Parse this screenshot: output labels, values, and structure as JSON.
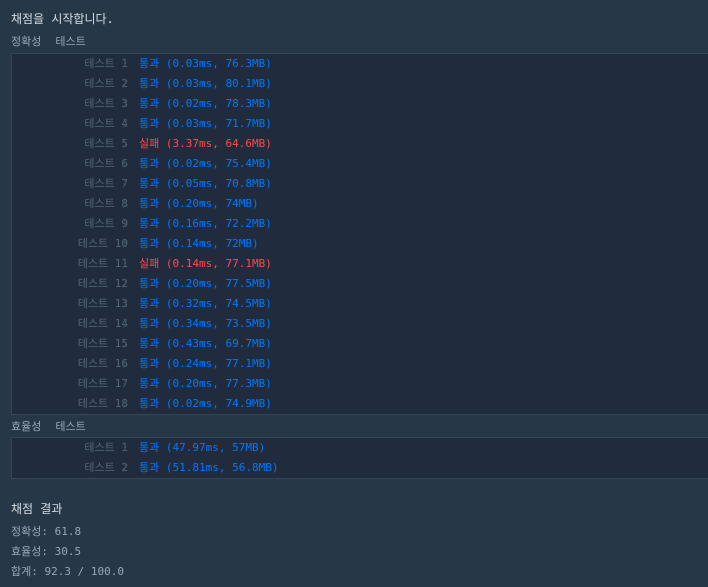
{
  "start_message": "채점을 시작합니다.",
  "accuracy": {
    "title_a": "정확성",
    "title_b": "테스트",
    "tests": [
      {
        "name": "테스트 1",
        "result": "통과",
        "detail": "(0.03ms, 76.3MB)",
        "status": "pass"
      },
      {
        "name": "테스트 2",
        "result": "통과",
        "detail": "(0.03ms, 80.1MB)",
        "status": "pass"
      },
      {
        "name": "테스트 3",
        "result": "통과",
        "detail": "(0.02ms, 78.3MB)",
        "status": "pass"
      },
      {
        "name": "테스트 4",
        "result": "통과",
        "detail": "(0.03ms, 71.7MB)",
        "status": "pass"
      },
      {
        "name": "테스트 5",
        "result": "실패",
        "detail": "(3.37ms, 64.6MB)",
        "status": "fail"
      },
      {
        "name": "테스트 6",
        "result": "통과",
        "detail": "(0.02ms, 75.4MB)",
        "status": "pass"
      },
      {
        "name": "테스트 7",
        "result": "통과",
        "detail": "(0.05ms, 70.8MB)",
        "status": "pass"
      },
      {
        "name": "테스트 8",
        "result": "통과",
        "detail": "(0.20ms, 74MB)",
        "status": "pass"
      },
      {
        "name": "테스트 9",
        "result": "통과",
        "detail": "(0.16ms, 72.2MB)",
        "status": "pass"
      },
      {
        "name": "테스트 10",
        "result": "통과",
        "detail": "(0.14ms, 72MB)",
        "status": "pass"
      },
      {
        "name": "테스트 11",
        "result": "실패",
        "detail": "(0.14ms, 77.1MB)",
        "status": "fail"
      },
      {
        "name": "테스트 12",
        "result": "통과",
        "detail": "(0.20ms, 77.5MB)",
        "status": "pass"
      },
      {
        "name": "테스트 13",
        "result": "통과",
        "detail": "(0.32ms, 74.5MB)",
        "status": "pass"
      },
      {
        "name": "테스트 14",
        "result": "통과",
        "detail": "(0.34ms, 73.5MB)",
        "status": "pass"
      },
      {
        "name": "테스트 15",
        "result": "통과",
        "detail": "(0.43ms, 69.7MB)",
        "status": "pass"
      },
      {
        "name": "테스트 16",
        "result": "통과",
        "detail": "(0.24ms, 77.1MB)",
        "status": "pass"
      },
      {
        "name": "테스트 17",
        "result": "통과",
        "detail": "(0.20ms, 77.3MB)",
        "status": "pass"
      },
      {
        "name": "테스트 18",
        "result": "통과",
        "detail": "(0.02ms, 74.9MB)",
        "status": "pass"
      }
    ]
  },
  "efficiency": {
    "title_a": "효율성",
    "title_b": "테스트",
    "tests": [
      {
        "name": "테스트 1",
        "result": "통과",
        "detail": "(47.97ms, 57MB)",
        "status": "pass"
      },
      {
        "name": "테스트 2",
        "result": "통과",
        "detail": "(51.81ms, 56.8MB)",
        "status": "pass"
      }
    ]
  },
  "separator_glyph": "〉",
  "final": {
    "title": "채점 결과",
    "accuracy_score": "정확성: 61.8",
    "efficiency_score": "효율성: 30.5",
    "total_score": "합계: 92.3 / 100.0"
  },
  "colors": {
    "pass": "#0078ff",
    "fail": "#ff4a4a",
    "background": "#263747",
    "box": "#202b3d"
  }
}
